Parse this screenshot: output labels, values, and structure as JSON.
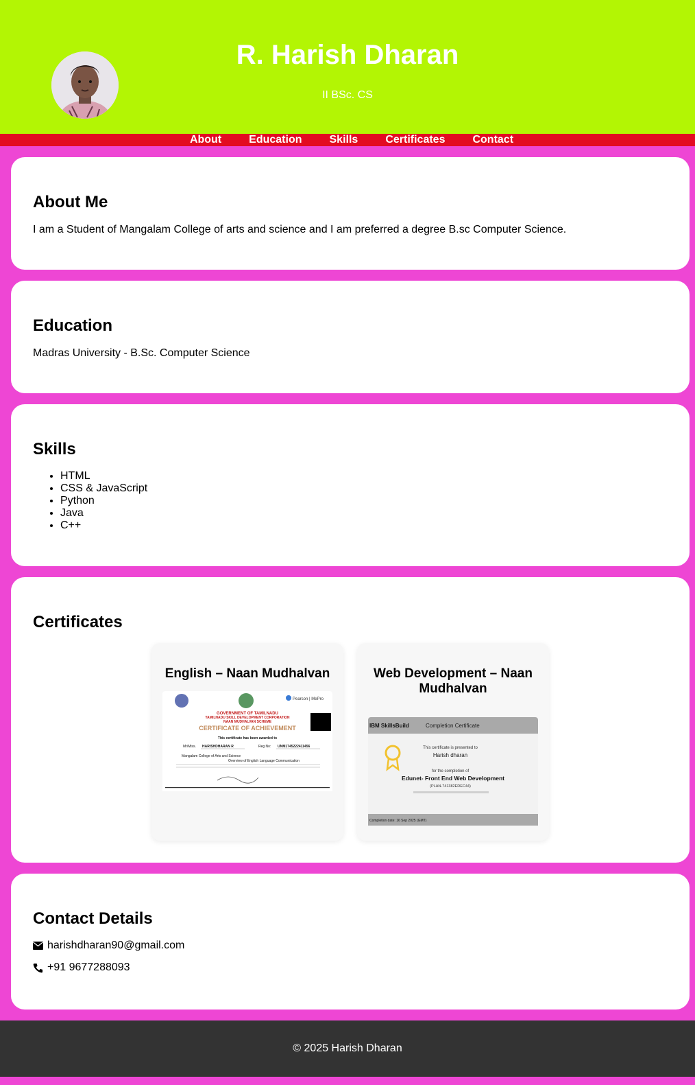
{
  "header": {
    "name": "R. Harish Dharan",
    "subtitle": "II BSc. CS",
    "avatar_icon": "profile-photo"
  },
  "nav": {
    "items": [
      "About",
      "Education",
      "Skills",
      "Certificates",
      "Contact"
    ]
  },
  "about": {
    "heading": "About Me",
    "text": "I am a Student of Mangalam College of arts and science and I am preferred a degree B.sc Computer Science."
  },
  "education": {
    "heading": "Education",
    "text": "Madras University - B.Sc. Computer Science"
  },
  "skills": {
    "heading": "Skills",
    "items": [
      "HTML",
      "CSS & JavaScript",
      "Python",
      "Java",
      "C++"
    ]
  },
  "certificates": {
    "heading": "Certificates",
    "items": [
      {
        "title": "English – Naan Mudhalvan",
        "img": {
          "gov": "GOVERNMENT OF TAMILNADU",
          "corp": "TAMILNADU SKILL DEVELOPMENT CORPORATION",
          "scheme": "NAAN MUDHALVAN SCHEME",
          "heading": "CERTIFICATE OF ACHIEVEMENT",
          "awarded": "This certificate has been awarded to",
          "name": "HARISHDHARAN R",
          "regno": "UNM1745222411456",
          "college": "Mangalam College of Arts and Science",
          "course": "Overview of English Language Communication",
          "partner": "Pearson MePro"
        }
      },
      {
        "title": "Web Development – Naan Mudhalvan",
        "img": {
          "brand": "IBM SkillsBuild",
          "label": "Completion Certificate",
          "presented": "This certificate is presented to",
          "name": "Harish dharan",
          "for": "for the completion of",
          "course": "Edunet- Front End Web Development",
          "plan": "(PLAN-741382EDEC44)",
          "footer": "Completion date: 16 Sep 2025 (GMT)"
        }
      }
    ]
  },
  "contact": {
    "heading": "Contact Details",
    "email": "harishdharan90@gmail.com",
    "phone": "+91 9677288093"
  },
  "footer": {
    "text": "© 2025 Harish Dharan"
  },
  "colors": {
    "header_bg": "#b3f504",
    "nav_bg": "#e30b22",
    "page_bg": "#ee46d4",
    "footer_bg": "#333333"
  }
}
